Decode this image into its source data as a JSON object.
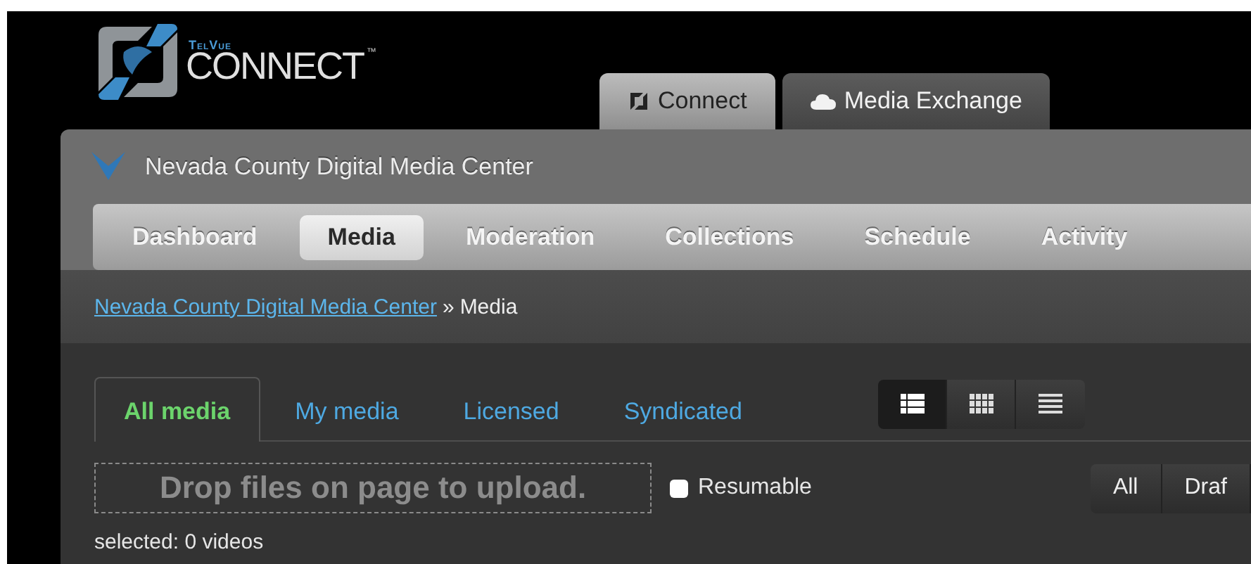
{
  "logo": {
    "brand": "TelVue",
    "name": "CONNECT",
    "trademark": "™"
  },
  "app_tabs": [
    {
      "label": "Connect",
      "kind": "connect",
      "selected": true
    },
    {
      "label": "Media Exchange",
      "kind": "cloud",
      "selected": false
    }
  ],
  "site_title": "Nevada County Digital Media Center",
  "nav": [
    {
      "label": "Dashboard",
      "selected": false
    },
    {
      "label": "Media",
      "selected": true
    },
    {
      "label": "Moderation",
      "selected": false
    },
    {
      "label": "Collections",
      "selected": false
    },
    {
      "label": "Schedule",
      "selected": false
    },
    {
      "label": "Activity",
      "selected": false
    }
  ],
  "breadcrumb": {
    "link": "Nevada County Digital Media Center",
    "separator": "»",
    "current": "Media"
  },
  "media_tabs": [
    {
      "label": "All media",
      "selected": true
    },
    {
      "label": "My media",
      "selected": false
    },
    {
      "label": "Licensed",
      "selected": false
    },
    {
      "label": "Syndicated",
      "selected": false
    }
  ],
  "view_modes": [
    {
      "kind": "list",
      "selected": true
    },
    {
      "kind": "grid",
      "selected": false
    },
    {
      "kind": "rows",
      "selected": false
    }
  ],
  "drop_zone": "Drop files on page to upload.",
  "resumable": {
    "label": "Resumable",
    "checked": false
  },
  "filters": [
    "All",
    "Draf"
  ],
  "selection_status": "selected: 0 videos"
}
